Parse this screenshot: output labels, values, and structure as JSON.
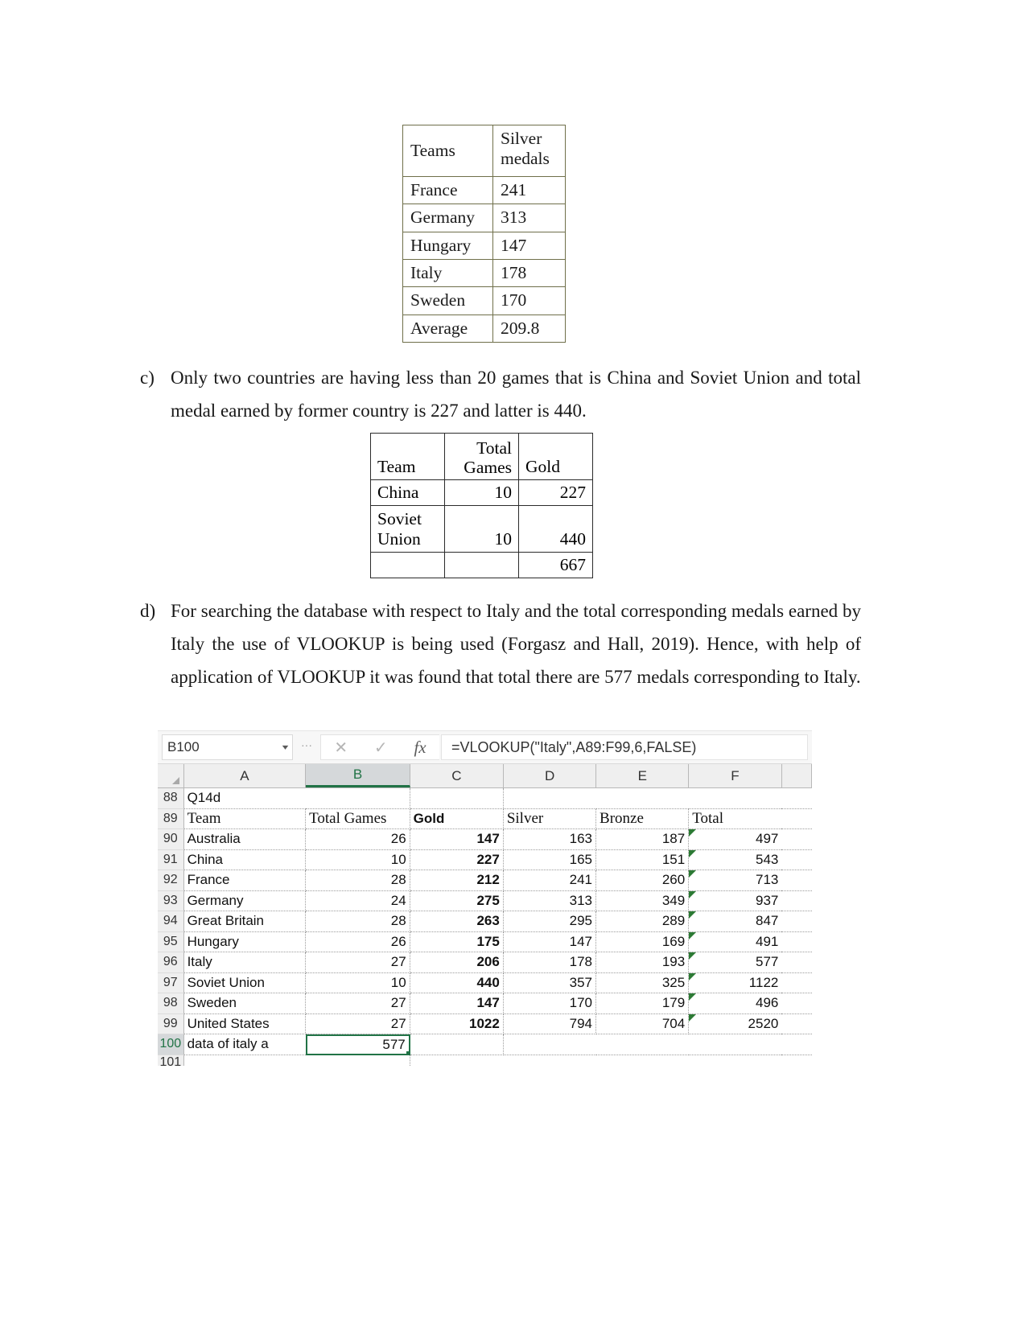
{
  "table_silver_medals": {
    "headers": [
      "Teams",
      "Silver medals"
    ],
    "header_line1": "Silver",
    "header_line2": "medals",
    "rows": [
      [
        "France",
        "241"
      ],
      [
        "Germany",
        "313"
      ],
      [
        "Hungary",
        "147"
      ],
      [
        "Italy",
        "178"
      ],
      [
        "Sweden",
        "170"
      ],
      [
        "Average",
        "209.8"
      ]
    ]
  },
  "paragraph_c": {
    "marker": "c)",
    "text": "Only two countries are having less than 20 games that is China and Soviet Union and total medal earned by former country is 227 and latter is 440."
  },
  "table_china_soviet": {
    "headers": [
      "Team",
      "Total Games",
      "Gold"
    ],
    "header_total": "Total",
    "header_games": "Games",
    "rows": [
      {
        "team": "China",
        "team_l1": "China",
        "team_l2": "",
        "games": "10",
        "gold": "227"
      },
      {
        "team": "Soviet Union",
        "team_l1": "Soviet",
        "team_l2": "Union",
        "games": "10",
        "gold": "440"
      },
      {
        "team": "",
        "team_l1": "",
        "team_l2": "",
        "games": "",
        "gold": "667"
      }
    ]
  },
  "paragraph_d": {
    "marker": "d)",
    "text": "For searching the database with respect to Italy and the total corresponding medals earned by Italy the use of VLOOKUP is being used (Forgasz and Hall, 2019). Hence, with help of application of VLOOKUP it was found that total there are 577 medals corresponding to Italy."
  },
  "excel": {
    "name_box": {
      "value": "B100",
      "caret": "▾"
    },
    "buttons": {
      "cancel": "✕",
      "enter": "✓",
      "function": "fx"
    },
    "formula_bar": {
      "value": "=VLOOKUP(\"Italy\",A89:F99,6,FALSE)"
    },
    "selected_column": "B",
    "selected_cell": "B100",
    "accent_color": "#217346",
    "columns": [
      "A",
      "B",
      "C",
      "D",
      "E",
      "F"
    ],
    "row_numbers": [
      "88",
      "89",
      "90",
      "91",
      "92",
      "93",
      "94",
      "95",
      "96",
      "97",
      "98",
      "99",
      "100",
      "101"
    ],
    "rows": [
      {
        "num": "88",
        "a": "Q14d",
        "b": "",
        "c": "",
        "d": "",
        "e": "",
        "f": ""
      },
      {
        "num": "89",
        "a": "Team",
        "b": "Total Games",
        "c": "Gold",
        "d": "Silver",
        "e": "Bronze",
        "f": "Total"
      },
      {
        "num": "90",
        "a": "Australia",
        "b": "26",
        "c": "147",
        "d": "163",
        "e": "187",
        "f": "497"
      },
      {
        "num": "91",
        "a": "China",
        "b": "10",
        "c": "227",
        "d": "165",
        "e": "151",
        "f": "543"
      },
      {
        "num": "92",
        "a": "France",
        "b": "28",
        "c": "212",
        "d": "241",
        "e": "260",
        "f": "713"
      },
      {
        "num": "93",
        "a": "Germany",
        "b": "24",
        "c": "275",
        "d": "313",
        "e": "349",
        "f": "937"
      },
      {
        "num": "94",
        "a": "Great Britain",
        "b": "28",
        "c": "263",
        "d": "295",
        "e": "289",
        "f": "847"
      },
      {
        "num": "95",
        "a": "Hungary",
        "b": "26",
        "c": "175",
        "d": "147",
        "e": "169",
        "f": "491"
      },
      {
        "num": "96",
        "a": "Italy",
        "b": "27",
        "c": "206",
        "d": "178",
        "e": "193",
        "f": "577"
      },
      {
        "num": "97",
        "a": "Soviet Union",
        "b": "10",
        "c": "440",
        "d": "357",
        "e": "325",
        "f": "1122"
      },
      {
        "num": "98",
        "a": "Sweden",
        "b": "27",
        "c": "147",
        "d": "170",
        "e": "179",
        "f": "496"
      },
      {
        "num": "99",
        "a": "United States",
        "b": "27",
        "c": "1022",
        "d": "794",
        "e": "704",
        "f": "2520"
      },
      {
        "num": "100",
        "a": "data of italy a",
        "b": "577",
        "c": "",
        "d": "",
        "e": "",
        "f": ""
      },
      {
        "num": "101",
        "a": "",
        "b": "",
        "c": "",
        "d": "",
        "e": "",
        "f": ""
      }
    ]
  }
}
